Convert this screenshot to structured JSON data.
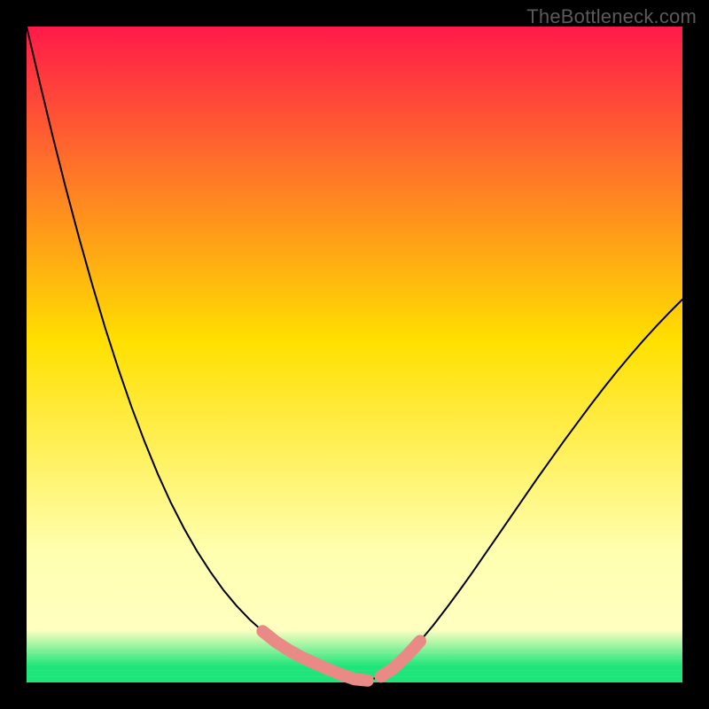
{
  "watermark": "TheBottleneck.com",
  "colors": {
    "page_bg": "#000000",
    "gradient_top": "#ff1a4a",
    "gradient_mid": "#ffe000",
    "gradient_soft": "#ffffb0",
    "gradient_green": "#1ee57a",
    "curve_stroke": "#000000",
    "highlight_stroke": "#e98a86"
  },
  "layout": {
    "inner_x": 30,
    "inner_y": 30,
    "inner_w": 740,
    "inner_h": 740
  },
  "chart_data": {
    "type": "line",
    "title": "",
    "xlabel": "",
    "ylabel": "",
    "xlim": [
      0,
      100
    ],
    "ylim": [
      0,
      100
    ],
    "x": [
      0,
      2,
      4,
      6,
      8,
      10,
      12,
      14,
      16,
      18,
      20,
      22,
      24,
      26,
      28,
      30,
      32,
      34,
      36,
      38,
      40,
      42,
      44,
      46,
      48,
      50,
      52,
      54,
      56,
      58,
      60,
      62,
      64,
      66,
      68,
      70,
      72,
      74,
      76,
      78,
      80,
      82,
      84,
      86,
      88,
      90,
      92,
      94,
      96,
      98,
      100
    ],
    "series": [
      {
        "name": "curve",
        "values": [
          100,
          91.5,
          83.2,
          75.3,
          67.8,
          60.7,
          54.0,
          47.8,
          42.0,
          36.7,
          31.8,
          27.4,
          23.5,
          20.0,
          16.9,
          14.1,
          11.7,
          9.6,
          7.8,
          6.2,
          4.9,
          3.8,
          2.9,
          2.0,
          1.2,
          0.5,
          0.3,
          0.9,
          2.2,
          4.1,
          6.3,
          8.7,
          11.3,
          14.0,
          16.8,
          19.7,
          22.6,
          25.5,
          28.4,
          31.3,
          34.1,
          36.9,
          39.6,
          42.3,
          44.9,
          47.4,
          49.8,
          52.1,
          54.3,
          56.4,
          58.4
        ]
      }
    ],
    "highlight_segments": [
      {
        "x_range": [
          36,
          44
        ]
      },
      {
        "x_range": [
          44,
          52
        ]
      },
      {
        "x_range": [
          54,
          60
        ]
      }
    ],
    "gradient_stops": [
      {
        "offset": 0.0,
        "color": "#ff1a4a"
      },
      {
        "offset": 0.48,
        "color": "#ffe000"
      },
      {
        "offset": 0.8,
        "color": "#ffffb0"
      },
      {
        "offset": 0.92,
        "color": "#ffffc0"
      },
      {
        "offset": 0.975,
        "color": "#1ee57a"
      },
      {
        "offset": 1.0,
        "color": "#1ee57a"
      }
    ]
  }
}
